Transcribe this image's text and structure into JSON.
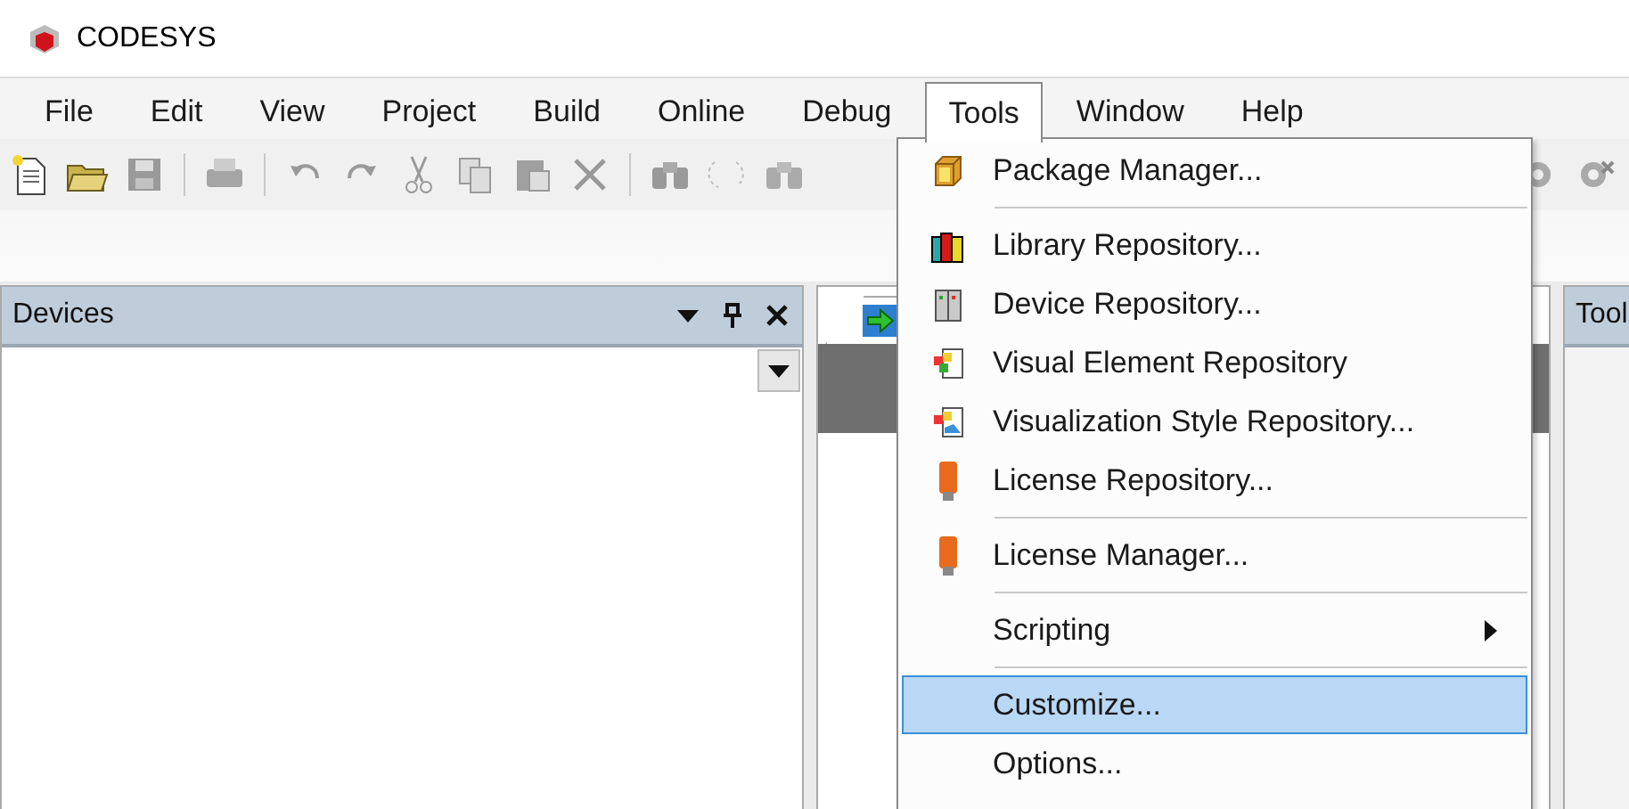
{
  "window": {
    "title": "CODESYS"
  },
  "menu_bar": [
    {
      "label": "File",
      "selected": false
    },
    {
      "label": "Edit",
      "selected": false
    },
    {
      "label": "View",
      "selected": false
    },
    {
      "label": "Project",
      "selected": false
    },
    {
      "label": "Build",
      "selected": false
    },
    {
      "label": "Online",
      "selected": false
    },
    {
      "label": "Debug",
      "selected": false
    },
    {
      "label": "Tools",
      "selected": true
    },
    {
      "label": "Window",
      "selected": false
    },
    {
      "label": "Help",
      "selected": false
    }
  ],
  "tools_menu": {
    "items": [
      {
        "kind": "item",
        "label": "Package Manager...",
        "selected": false
      },
      {
        "kind": "separator"
      },
      {
        "kind": "item",
        "label": "Library Repository...",
        "selected": false
      },
      {
        "kind": "item",
        "label": "Device Repository...",
        "selected": false
      },
      {
        "kind": "item",
        "label": "Visual Element Repository",
        "selected": false
      },
      {
        "kind": "item",
        "label": "Visualization Style Repository...",
        "selected": false
      },
      {
        "kind": "item",
        "label": "License Repository...",
        "selected": false
      },
      {
        "kind": "separator"
      },
      {
        "kind": "item",
        "label": "License Manager...",
        "selected": false
      },
      {
        "kind": "separator"
      },
      {
        "kind": "submenu",
        "label": "Scripting",
        "selected": false
      },
      {
        "kind": "separator"
      },
      {
        "kind": "item",
        "label": "Customize...",
        "selected": true
      },
      {
        "kind": "item",
        "label": "Options...",
        "selected": false
      }
    ]
  },
  "devices_panel": {
    "title": "Devices"
  },
  "side_panel": {
    "title": "Tool"
  }
}
